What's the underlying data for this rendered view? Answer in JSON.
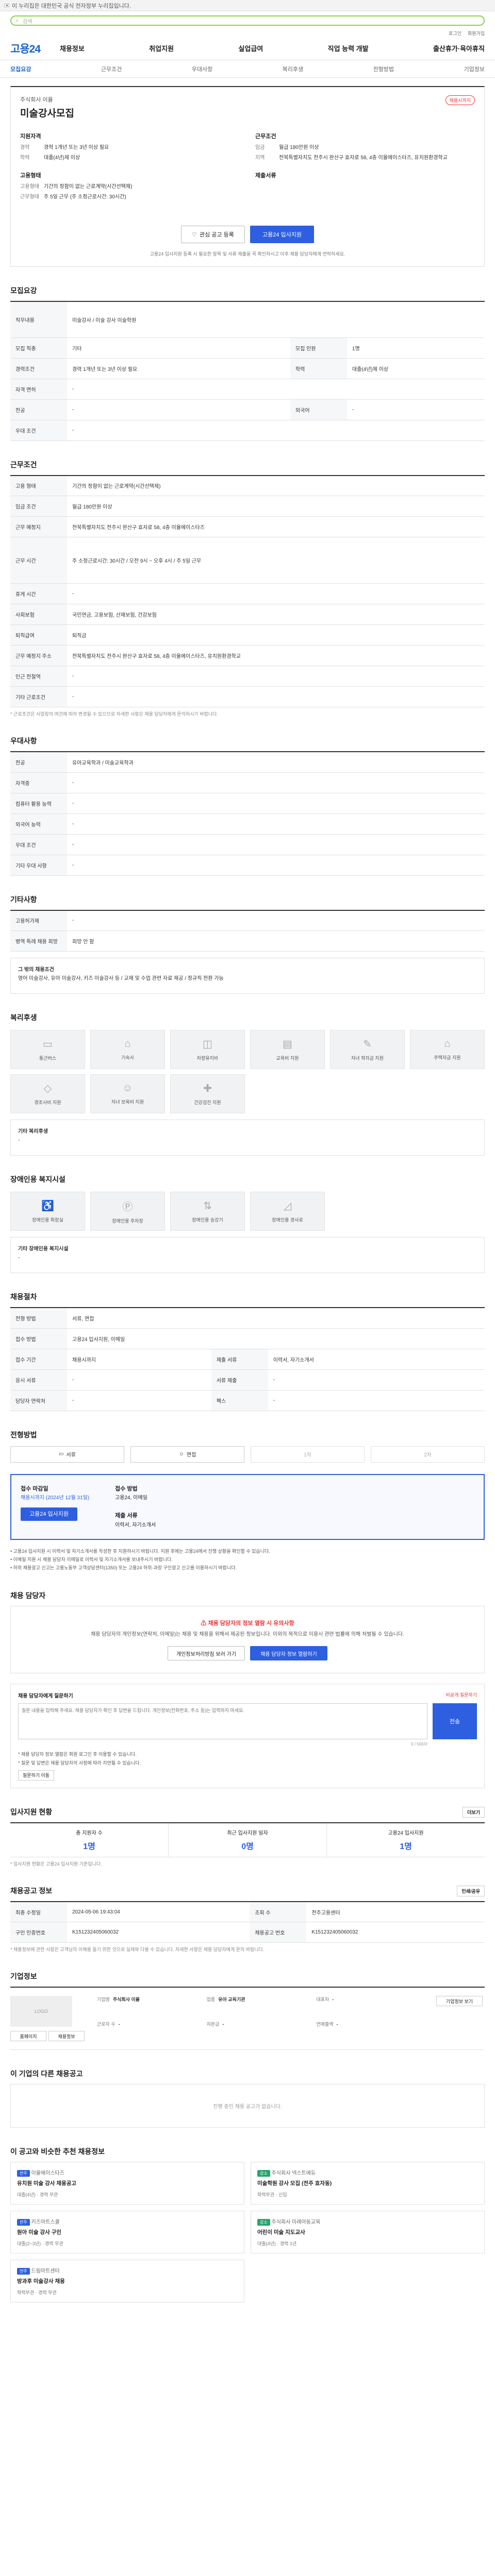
{
  "topbar": {
    "text": "이 누리집은 대한민국 공식 전자정부 누리집입니다."
  },
  "search": {
    "icon": "search-icon",
    "placeholder": "검색"
  },
  "util": [
    "로그인",
    "회원가입"
  ],
  "gnb": {
    "logo": "고용24",
    "menu": [
      "채용정보",
      "취업지원",
      "실업급여",
      "직업 능력 개발",
      "출산휴가·육아휴직"
    ]
  },
  "snb": [
    "모집요강",
    "근무조건",
    "우대사항",
    "복리후생",
    "전형방법",
    "기업정보"
  ],
  "hero": {
    "company": "주식회사 이율",
    "title": "미술강사모집",
    "badge": "채용시까지",
    "left_head": "지원자격",
    "left_rows": [
      {
        "k": "경력",
        "v": "경력 1개년 또는 3년 이상 필요"
      },
      {
        "k": "학력",
        "v": "대졸(4년)제 이상"
      }
    ],
    "left_head2": "고용형태",
    "left_rows2": [
      {
        "k": "고용형태",
        "v": "기간의 정함이 없는 근로계약(시간선택제)"
      },
      {
        "k": "근무형태",
        "v": "주 5일 근무 (주 소정근로시간: 30시간)"
      }
    ],
    "right_head": "근무조건",
    "right_rows": [
      {
        "k": "임금",
        "v": "월급 180만원 이상"
      },
      {
        "k": "지역",
        "v": "전북특별자치도 전주시 완산구 효자로 58, 4층 이율에이스타즈, 유치원환경학교"
      }
    ],
    "right_head2": "제출서류",
    "save_btn": "관심 공고 등록",
    "apply_btn": "고용24 입사지원",
    "note": "고용24 입사지원 등록 시 필요한 항목 및 서류 제출을 꼭 확인하시고 이후 채용 담당자에게 연락하세요."
  },
  "recruit": {
    "title": "모집요강",
    "job_head": "직무내용",
    "job_desc": "미술강사 / 미술 강사 미술학원",
    "rows": [
      [
        {
          "k": "모집 직종",
          "v": "기타"
        },
        {
          "k": "모집 인원",
          "v": "1명"
        }
      ],
      [
        {
          "k": "경력조건",
          "v": "경력 1개년 또는 3년 이상 필요"
        },
        {
          "k": "학력",
          "v": "대졸(4년)제 이상"
        }
      ],
      [
        {
          "k": "자격 면허",
          "v": "-"
        },
        {
          "k": "",
          "v": ""
        }
      ],
      [
        {
          "k": "전공",
          "v": "-"
        },
        {
          "k": "외국어",
          "v": "-"
        }
      ],
      [
        {
          "k": "우대 조건",
          "v": "-"
        },
        {
          "k": "",
          "v": ""
        }
      ]
    ]
  },
  "work": {
    "title": "근무조건",
    "rows": [
      {
        "k": "고용 형태",
        "v": "기간의 정함이 없는 근로계약(시간선택제)"
      },
      {
        "k": "임금 조건",
        "v": "월급 180만원 이상"
      },
      {
        "k": "근무 예정지",
        "v": "전북특별자치도 전주시 완산구 효자로 58, 4층 이율에이스타즈"
      },
      {
        "k": "근무 시간",
        "v": "주 소정근로시간: 30시간 / 오전 9시 ~ 오후 4시 / 주 5일 근무"
      },
      {
        "k": "휴게 시간",
        "v": "-"
      },
      {
        "k": "사회보험",
        "v": "국민연금, 고용보험, 산재보험, 건강보험"
      },
      {
        "k": "퇴직급여",
        "v": "퇴직금"
      },
      {
        "k": "근무 예정지 주소",
        "v": "전북특별자치도 전주시 완산구 효자로 58, 4층 이율에이스타즈, 유치원환경학교"
      },
      {
        "k": "인근 전철역",
        "v": "-"
      },
      {
        "k": "기타 근로조건",
        "v": "-"
      }
    ],
    "caption": "* 근로조건은 사업장의 여건에 따라 변경될 수 있으므로 자세한 사항은 채용 담당자에게 문의하시기 바랍니다."
  },
  "prefer": {
    "title": "우대사항",
    "rows": [
      {
        "k": "전공",
        "v": "유아교육학과 / 미술교육학과"
      },
      {
        "k": "자격증",
        "v": "-"
      },
      {
        "k": "컴퓨터 활용 능력",
        "v": "-"
      },
      {
        "k": "외국어 능력",
        "v": "-"
      },
      {
        "k": "우대 조건",
        "v": "-"
      },
      {
        "k": "기타 우대 사항",
        "v": "-"
      }
    ]
  },
  "other": {
    "title": "기타사항",
    "rows": [
      {
        "k": "고용허가제",
        "v": "-"
      },
      {
        "k": "병역 특례 채용 희망",
        "v": "희망 안 함"
      }
    ],
    "box_head": "그 밖의 채용조건",
    "box_text": "영어 미술강사, 유아 미술강사, 키즈 미술강사 등 / 교재 및 수업 관련 자료 제공 / 정규직 전환 가능"
  },
  "welfare": {
    "title": "복리후생",
    "items": [
      "통근버스",
      "기숙사",
      "차량유지비",
      "교육비 지원",
      "자녀 학자금 지원",
      "주택자금 지원",
      "경조사비 지원",
      "자녀 보육비 지원",
      "건강검진 지원"
    ],
    "box_head": "기타 복리후생",
    "box_text": "-"
  },
  "disabled": {
    "title": "장애인용 복지시설",
    "items": [
      "장애인용 화장실",
      "장애인용 주차장",
      "장애인용 승강기",
      "장애인용 경사로"
    ],
    "box_head": "기타 장애인용 복지시설",
    "box_text": "-"
  },
  "selection": {
    "title": "채용절차",
    "rows": [
      [
        {
          "k": "전형 방법",
          "v": "서류, 면접"
        },
        {
          "k": "",
          "v": ""
        }
      ],
      [
        {
          "k": "접수 방법",
          "v": "고용24 입사지원, 이메일"
        },
        {
          "k": "",
          "v": ""
        }
      ],
      [
        {
          "k": "접수 기간",
          "v": "채용시까지"
        },
        {
          "k": "제출 서류",
          "v": "이력서, 자기소개서"
        }
      ],
      [
        {
          "k": "응시 서류",
          "v": "-"
        },
        {
          "k": "서류 제출",
          "v": "-"
        }
      ],
      [
        {
          "k": "담당자 연락처",
          "v": "-"
        },
        {
          "k": "팩스",
          "v": "-"
        }
      ]
    ]
  },
  "process": {
    "title": "전형방법",
    "steps": [
      "서류",
      "면접",
      "1차",
      "2차"
    ]
  },
  "apply": {
    "col1_head": "접수 마감일",
    "col1_val": "채용시까지 (2024년 12월 31일)",
    "col1_btn": "고용24 입사지원",
    "col2_head": "접수 방법",
    "col2_val": "고용24, 이메일",
    "col3_head": "제출 서류",
    "col3_val": "이력서, 자기소개서",
    "bullets": [
      "• 고용24 입사지원 시 이력서 및 자기소개서를 작성한 후 지원하시기 바랍니다. 지원 후에는 고용24에서 진행 상황을 확인할 수 있습니다.",
      "• 이메일 지원 시 채용 담당자 이메일로 이력서 및 자기소개서를 보내주시기 바랍니다.",
      "• 허위 채용광고 신고는 고용노동부 고객상담센터(1350) 또는 고용24 허위·과장 구인광고 신고를 이용하시기 바랍니다."
    ]
  },
  "charge": {
    "title": "채용 담당자",
    "notice": "채용 담당자의 정보 열람 시 유의사항",
    "text": "채용 담당자의 개인정보(연락처, 이메일)는 채용 및 채용을 위해서 제공된 정보입니다. 이외의 목적으로 이용시 관련 법률에 의해 처벌될 수 있습니다.",
    "btn1": "개인정보처리방침 보러 가기",
    "btn2": "채용 담당자 정보 열람하기",
    "ask_head": "채용 담당자에게 질문하기",
    "ask_sub": "비공개 질문하기",
    "ask_placeholder": "질문 내용을 입력해 주세요. 채용 담당자가 확인 후 답변을 드립니다. 개인정보(전화번호, 주소 등)는 입력하지 마세요.",
    "ask_count": "0 / 500자",
    "send": "전송",
    "tips": [
      "* 채용 담당자 정보 열람은 회원 로그인 후 이용할 수 있습니다.",
      "* 질문 및 답변은 채용 담당자의 사정에 따라 지연될 수 있습니다."
    ],
    "more": "질문하기 이동"
  },
  "stats": {
    "title": "입사지원 현황",
    "more": "더보기",
    "items": [
      {
        "label": "총 지원자 수",
        "value": "1명"
      },
      {
        "label": "최근 입사지원 일자",
        "value": "0명"
      },
      {
        "label": "고용24 입사지원",
        "value": "1명"
      }
    ],
    "caption": "* 입사지원 현황은 고용24 입사지원 기준입니다."
  },
  "info": {
    "title": "채용공고 정보",
    "btn": "인쇄/공유",
    "rows": [
      [
        {
          "k": "최종 수정일",
          "v": "2024-05-06 19:43:04"
        },
        {
          "k": "조회 수",
          "v": "전주고용센터"
        }
      ],
      [
        {
          "k": "구인 인증번호",
          "v": "K151232405060032"
        },
        {
          "k": "채용공고 번호",
          "v": "K151232405060032"
        }
      ]
    ],
    "caption": "* 채용정보에 관한 사항은 고객님의 이해를 돕기 위한 것으로 실제와 다를 수 있습니다. 자세한 사항은 채용 담당자에게 문의 바랍니다."
  },
  "corp": {
    "title": "기업정보",
    "logo": "LOGO",
    "meta": [
      {
        "k": "기업명",
        "v": "주식회사 이율"
      },
      {
        "k": "업종",
        "v": "유아 교육기관"
      },
      {
        "k": "대표자",
        "v": "-"
      },
      {
        "k": "근로자 수",
        "v": "-"
      },
      {
        "k": "자본금",
        "v": "-"
      },
      {
        "k": "연매출액",
        "v": "-"
      }
    ],
    "btn1": "홈페이지",
    "btn2": "채용정보",
    "btn3": "기업정보 보기"
  },
  "same": {
    "title": "이 기업의 다른 채용공고",
    "empty": "진행 중인 채용 공고가 없습니다."
  },
  "recs": {
    "title": "이 공고와 비슷한 추천 채용정보",
    "items": [
      {
        "tag": "전주",
        "company": "이율에이스타즈",
        "title": "유치원 미술 강사 채용공고",
        "meta": "대졸(4년) · 경력 무관"
      },
      {
        "tag": "강소",
        "company": "주식회사 넥스트에듀",
        "title": "미술학원 강사 모집 (전주 효자동)",
        "meta": "학력무관 · 신입"
      },
      {
        "tag": "전주",
        "company": "키즈아트스쿨",
        "title": "원아 미술 강사 구인",
        "meta": "대졸(2~3년) · 경력 무관"
      },
      {
        "tag": "강소",
        "company": "주식회사 미래아동교육",
        "title": "어린이 미술 지도교사",
        "meta": "대졸(4년) · 경력 1년"
      },
      {
        "tag": "전주",
        "company": "드림아트센터",
        "title": "방과후 미술강사 채용",
        "meta": "학력무관 · 경력 무관"
      }
    ]
  }
}
